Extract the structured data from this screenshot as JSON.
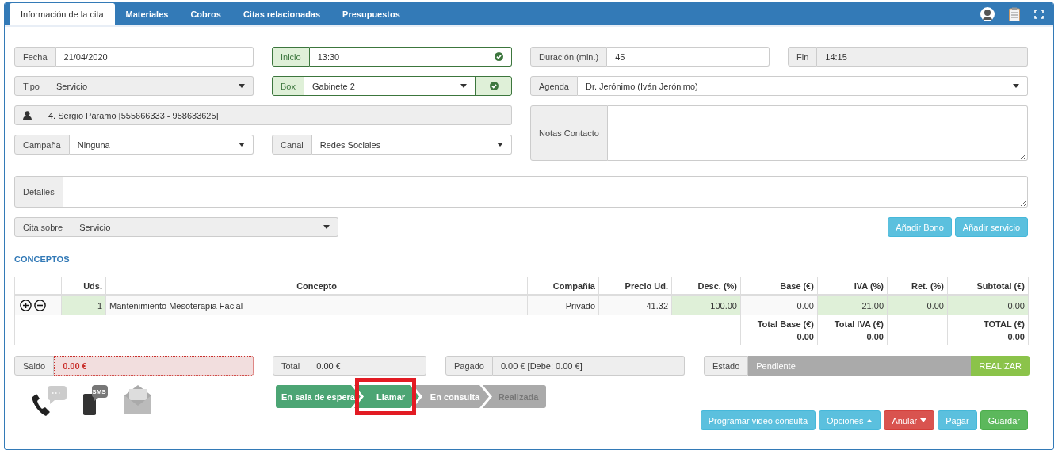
{
  "tabs": [
    {
      "label": "Información de la cita",
      "selected": true
    },
    {
      "label": "Materiales",
      "selected": false
    },
    {
      "label": "Cobros",
      "selected": false
    },
    {
      "label": "Citas relacionadas",
      "selected": false
    },
    {
      "label": "Presupuestos",
      "selected": false
    }
  ],
  "fields": [
    {
      "kind": "input",
      "label": "Fecha",
      "value": "21/04/2020",
      "validated": false
    },
    {
      "kind": "input",
      "label": "Inicio",
      "value": "13:30",
      "validated": true
    },
    {
      "kind": "input",
      "label": "Duración (min.)",
      "value": "45",
      "validated": false
    },
    {
      "kind": "readonly",
      "label": "Fin",
      "value": "14:15",
      "validated": false
    },
    {
      "kind": "select-readonly",
      "label": "Tipo",
      "value": "Servicio",
      "validated": false
    },
    {
      "kind": "select",
      "label": "Box",
      "value": "Gabinete 2",
      "validated": true
    },
    {
      "kind": "select",
      "label": "Agenda",
      "value": "Dr. Jerónimo (Iván Jerónimo)",
      "validated": false
    },
    {
      "kind": "contact",
      "value": "4. Sergio Páramo [555666333 - 958633625]",
      "validated": false
    },
    {
      "kind": "textarea",
      "label": "Notas Contacto",
      "validated": false
    },
    {
      "kind": "select",
      "label": "Campaña",
      "value": "Ninguna",
      "validated": false
    },
    {
      "kind": "select",
      "label": "Canal",
      "value": "Redes Sociales",
      "validated": false
    }
  ],
  "details": {
    "label": "Detalles"
  },
  "appointment_for": {
    "label": "Cita sobre",
    "value": "Servicio"
  },
  "add_buttons": [
    "Añadir Bono",
    "Añadir servicio"
  ],
  "concepts": {
    "title": "CONCEPTOS",
    "columns": [
      "Uds.",
      "Concepto",
      "Compañía",
      "Precio Ud.",
      "Desc. (%)",
      "Base (€)",
      "IVA (%)",
      "Ret. (%)",
      "Subtotal (€)"
    ],
    "rows": [
      {
        "cells": [
          {
            "text": "1",
            "editable": true
          },
          {
            "text": "Mantenimiento Mesoterapia Facial",
            "editable": false
          },
          {
            "text": "Privado",
            "editable": false
          },
          {
            "text": "41.32",
            "editable": false
          },
          {
            "text": "100.00",
            "editable": true
          },
          {
            "text": "0.00",
            "editable": false
          },
          {
            "text": "21.00",
            "editable": true
          },
          {
            "text": "0.00",
            "editable": true
          },
          {
            "text": "0.00",
            "editable": true
          }
        ]
      }
    ],
    "totals": [
      {
        "label": "Total Base (€)",
        "value": "0.00"
      },
      {
        "label": "Total IVA (€)",
        "value": "0.00"
      },
      {
        "label": "TOTAL (€)",
        "value": "0.00"
      }
    ]
  },
  "summary": [
    {
      "kind": "error",
      "label": "Saldo",
      "value": "0.00 €"
    },
    {
      "kind": "readonly",
      "label": "Total",
      "value": "0.00 €"
    },
    {
      "kind": "readonly",
      "label": "Pagado",
      "value": "0.00 € [Debe: 0.00 €]"
    },
    {
      "kind": "status",
      "label": "Estado",
      "value": "Pendiente",
      "action": "REALIZAR"
    }
  ],
  "contact_actions": [
    {
      "kind": "call"
    },
    {
      "kind": "sms",
      "badge": "SMS"
    },
    {
      "kind": "email"
    }
  ],
  "steps": [
    {
      "label": "En sala de espera",
      "kind": "done",
      "highlighted": false
    },
    {
      "label": "Llamar",
      "kind": "done",
      "highlighted": true
    },
    {
      "label": "En consulta",
      "kind": "next",
      "highlighted": false
    },
    {
      "label": "Realizada",
      "kind": "locked",
      "highlighted": false
    }
  ],
  "actions": [
    {
      "label": "Programar video consulta",
      "kind": "info"
    },
    {
      "label": "Opciones",
      "kind": "dropup"
    },
    {
      "label": "Anular",
      "kind": "dropdown"
    },
    {
      "label": "Pagar",
      "kind": "info"
    },
    {
      "label": "Guardar",
      "kind": "success"
    }
  ]
}
